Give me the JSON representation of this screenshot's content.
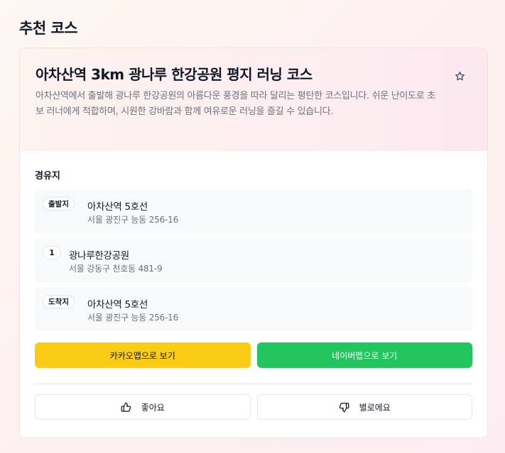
{
  "section": {
    "title": "추천 코스"
  },
  "course": {
    "title": "아차산역 3km 광나루 한강공원 평지 러닝 코스",
    "description": "아차산역에서 출발해 광나루 한강공원의 아름다운 풍경을 따라 달리는 평탄한 코스입니다. 쉬운 난이도로 초보 러너에게 적합하며, 시원한 강바람과 함께 여유로운 러닝을 즐길 수 있습니다.",
    "favorite_icon": "star-outline-icon"
  },
  "waypoints": {
    "label": "경유지",
    "items": [
      {
        "badge": "출발지",
        "name": "아차산역 5호선",
        "address": "서울 광진구 능동 256-16"
      },
      {
        "badge": "1",
        "name": "광나루한강공원",
        "address": "서울 강동구 천호동 481-9"
      },
      {
        "badge": "도착지",
        "name": "아차산역 5호선",
        "address": "서울 광진구 능동 256-16"
      }
    ]
  },
  "actions": {
    "kakao_label": "카카오맵으로 보기",
    "naver_label": "네이버맵으로 보기",
    "like_label": "좋아요",
    "dislike_label": "별로에요",
    "kakao_color": "#facc15",
    "naver_color": "#22c55e"
  }
}
